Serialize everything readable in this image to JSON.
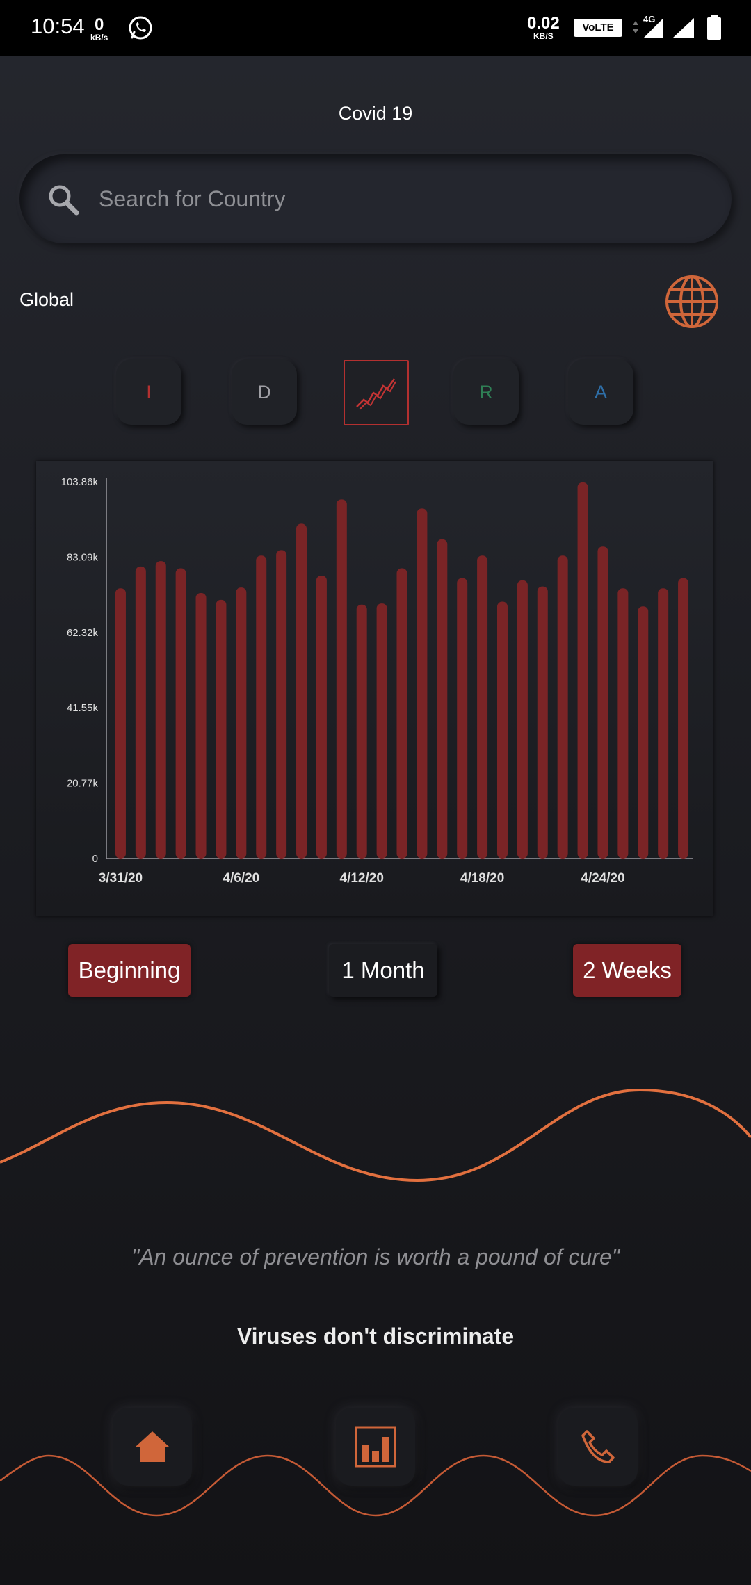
{
  "status_bar": {
    "time": "10:54",
    "speed_left_value": "0",
    "speed_left_unit": "kB/s",
    "speed_right_value": "0.02",
    "speed_right_unit": "KB/S",
    "volte": "VoLTE",
    "network": "4G"
  },
  "header": {
    "title": "Covid 19"
  },
  "search": {
    "placeholder": "Search for Country",
    "value": ""
  },
  "region": {
    "label": "Global"
  },
  "type_buttons": [
    {
      "label": "I",
      "color": "#b33030"
    },
    {
      "label": "D",
      "color": "#a0a0a5"
    },
    {
      "label": "trend",
      "color": "#c43434",
      "active": true
    },
    {
      "label": "R",
      "color": "#2f7f55"
    },
    {
      "label": "A",
      "color": "#2e6fa8"
    }
  ],
  "chart_data": {
    "type": "bar",
    "color": "#7a2426",
    "y_ticks": [
      "0",
      "20.77k",
      "41.55k",
      "62.32k",
      "83.09k",
      "103.86k"
    ],
    "x_ticks": [
      "3/31/20",
      "4/6/20",
      "4/12/20",
      "4/18/20",
      "4/24/20"
    ],
    "ylim": [
      0,
      103860
    ],
    "values": [
      74500,
      80500,
      82000,
      80000,
      73200,
      71300,
      74700,
      83500,
      85000,
      92300,
      78000,
      99000,
      70000,
      70300,
      80000,
      96500,
      88000,
      77300,
      83500,
      70800,
      76700,
      75000,
      83500,
      103700,
      86000,
      74500,
      69500,
      74500,
      77300
    ]
  },
  "range_buttons": {
    "beginning": "Beginning",
    "month": "1 Month",
    "weeks": "2 Weeks"
  },
  "quote": "\"An ounce of prevention is worth a pound of cure\"",
  "slogan": "Viruses don't discriminate",
  "nav": {
    "icons": [
      "home-icon",
      "bar-chart-icon",
      "phone-icon"
    ],
    "accent": "#d0663a"
  }
}
